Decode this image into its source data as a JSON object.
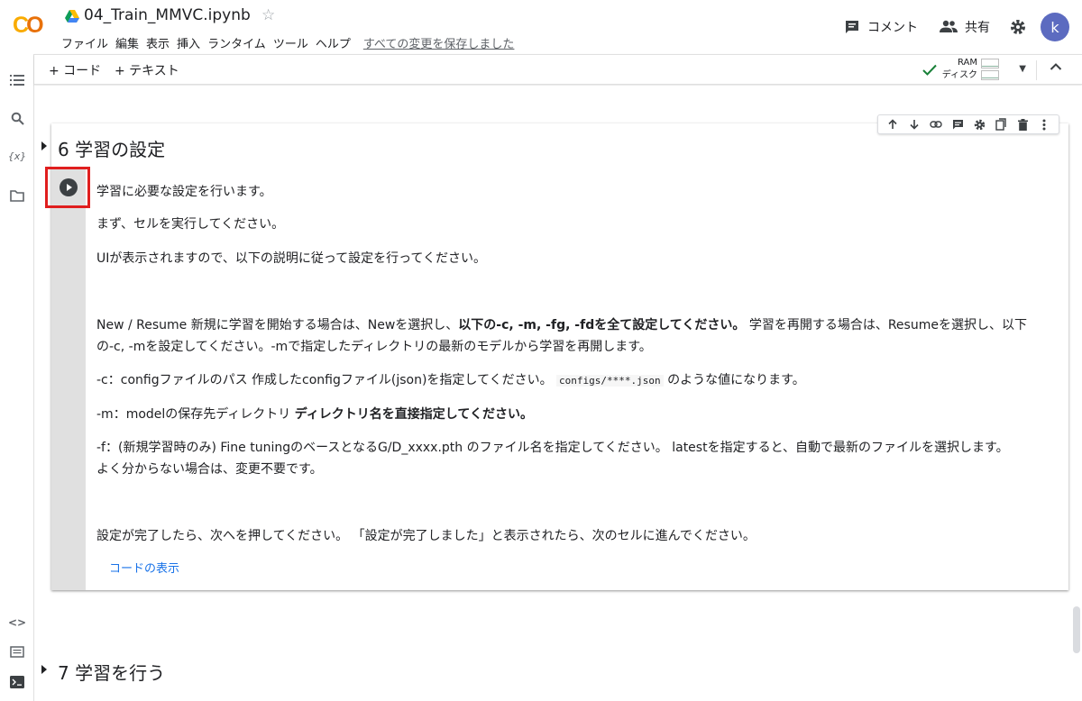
{
  "header": {
    "logo": "CO",
    "title": "04_Train_MMVC.ipynb",
    "menu": [
      "ファイル",
      "編集",
      "表示",
      "挿入",
      "ランタイム",
      "ツール",
      "ヘルプ"
    ],
    "saved_status": "すべての変更を保存しました",
    "comment_label": "コメント",
    "share_label": "共有",
    "avatar_letter": "k"
  },
  "toolbar": {
    "add_code": "+ コード",
    "add_text": "+ テキスト",
    "ram_label": "RAM",
    "disk_label": "ディスク"
  },
  "cell": {
    "heading": "6 学習の設定",
    "p1": "学習に必要な設定を行います。",
    "p2": "まず、セルを実行してください。",
    "p3": "UIが表示されますので、以下の説明に従って設定を行ってください。",
    "p4_a": "New / Resume 新規に学習を開始する場合は、Newを選択し、",
    "p4_b": "以下の-c, -m, -fg, -fdを全て設定してください。",
    "p4_c": " 学習を再開する場合は、Resumeを選択し、以下",
    "p4_line2": "の-c, -mを設定してください。-mで指定したディレクトリの最新のモデルから学習を再開します。",
    "p5_a": "-c：configファイルのパス 作成したconfigファイル(json)を指定してください。 ",
    "p5_code": "configs/****.json",
    "p5_c": " のような値になります。",
    "p6_a": "-m：modelの保存先ディレクトリ ",
    "p6_b": "ディレクトリ名を直接指定してください。",
    "p7_line1": "-f：(新規学習時のみ) Fine tuningのベースとなるG/D_xxxx.pth のファイル名を指定してください。 latestを指定すると、自動で最新のファイルを選択します。",
    "p7_line2": "よく分からない場合は、変更不要です。",
    "p8": "設定が完了したら、次へを押してください。 「設定が完了しました」と表示されたら、次のセルに進んでください。",
    "show_code": "コードの表示"
  },
  "next_section": {
    "heading": "7 学習を行う"
  }
}
